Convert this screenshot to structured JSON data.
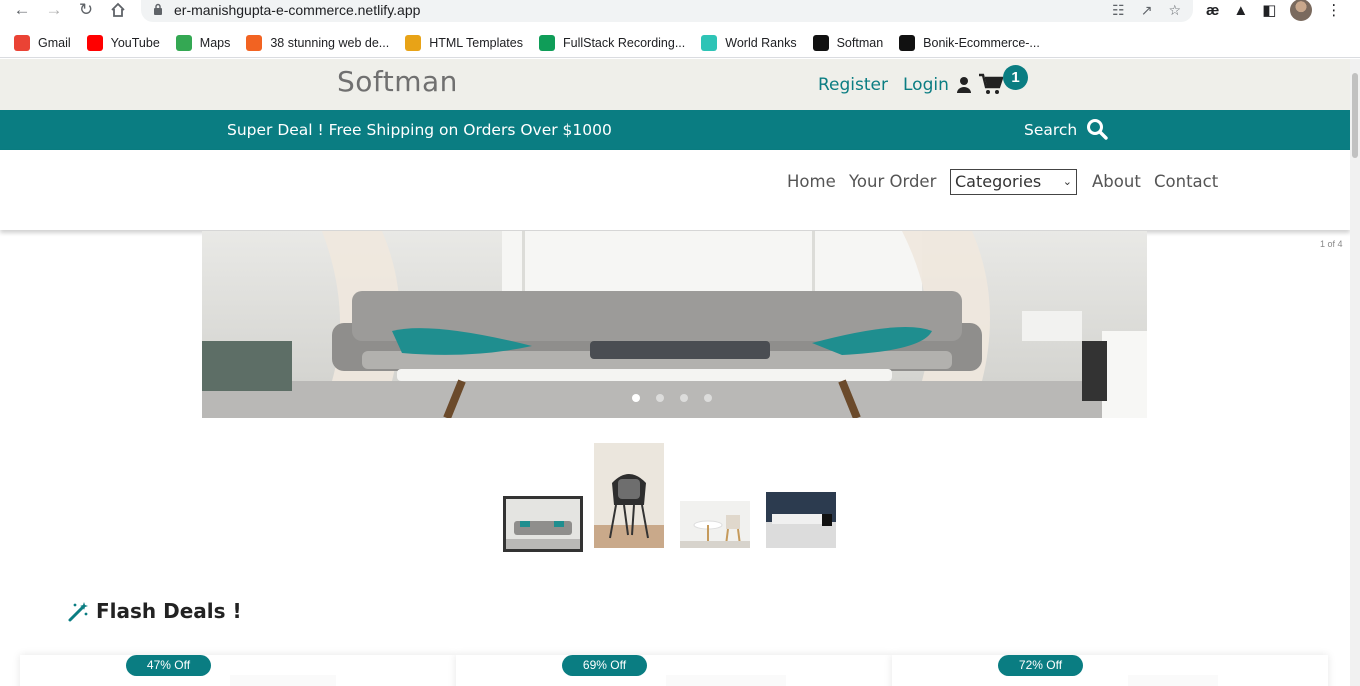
{
  "browser": {
    "url": "er-manishgupta-e-commerce.netlify.app",
    "bookmarks": [
      {
        "label": "Gmail",
        "icon": "gmail-icon",
        "color": "#EA4335"
      },
      {
        "label": "YouTube",
        "icon": "youtube-icon",
        "color": "#FF0000"
      },
      {
        "label": "Maps",
        "icon": "maps-icon",
        "color": "#34A853"
      },
      {
        "label": "38 stunning web de...",
        "icon": "99designs-icon",
        "color": "#F26322"
      },
      {
        "label": "HTML Templates",
        "icon": "search-bookmark-icon",
        "color": "#E8A317"
      },
      {
        "label": "FullStack Recording...",
        "icon": "sheets-icon",
        "color": "#0F9D58"
      },
      {
        "label": "World Ranks",
        "icon": "ranks-icon",
        "color": "#2EC4B6"
      },
      {
        "label": "Softman",
        "icon": "softman-icon",
        "color": "#111111"
      },
      {
        "label": "Bonik-Ecommerce-...",
        "icon": "github-icon",
        "color": "#111111"
      }
    ]
  },
  "header": {
    "brand": "Softman",
    "register": "Register",
    "login": "Login",
    "cart_count": "1"
  },
  "promo": {
    "text": "Super Deal ! Free Shipping on Orders Over $1000",
    "search_label": "Search"
  },
  "nav": {
    "home": "Home",
    "your_order": "Your Order",
    "categories": "Categories",
    "about": "About",
    "contact": "Contact"
  },
  "carousel": {
    "counter": "1 of 4",
    "slides": 4,
    "active_slide": 1
  },
  "flash": {
    "title": "Flash Deals !",
    "deals": [
      {
        "badge": "47% Off"
      },
      {
        "badge": "69% Off"
      },
      {
        "badge": "72% Off"
      }
    ]
  },
  "colors": {
    "accent": "#0a7d82",
    "topbar_bg": "#efefea"
  }
}
